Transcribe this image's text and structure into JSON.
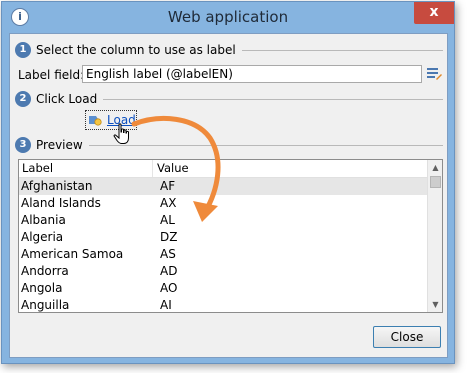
{
  "window": {
    "title": "Web application",
    "app_icon": "app-icon",
    "close_glyph": "x"
  },
  "steps": [
    {
      "number": "1",
      "text": "Select the column to use as label"
    },
    {
      "number": "2",
      "text": "Click Load"
    },
    {
      "number": "3",
      "text": "Preview"
    }
  ],
  "label_field": {
    "label": "Label field:",
    "value": "English label (@labelEN)"
  },
  "load": {
    "label": "Load"
  },
  "preview": {
    "columns": [
      "Label",
      "Value"
    ],
    "rows": [
      {
        "label": "Afghanistan",
        "value": "AF"
      },
      {
        "label": "Aland Islands",
        "value": "AX"
      },
      {
        "label": "Albania",
        "value": "AL"
      },
      {
        "label": "Algeria",
        "value": "DZ"
      },
      {
        "label": "American Samoa",
        "value": "AS"
      },
      {
        "label": "Andorra",
        "value": "AD"
      },
      {
        "label": "Angola",
        "value": "AO"
      },
      {
        "label": "Anguilla",
        "value": "AI"
      }
    ],
    "selected_row": 0
  },
  "footer": {
    "close_label": "Close"
  },
  "colors": {
    "titlebar": "#86b4e0",
    "close_button_bg": "#c74b3f",
    "badge": "#4d7ab0",
    "link": "#0b4fbf",
    "annotation_arrow": "#ef8a3b"
  }
}
